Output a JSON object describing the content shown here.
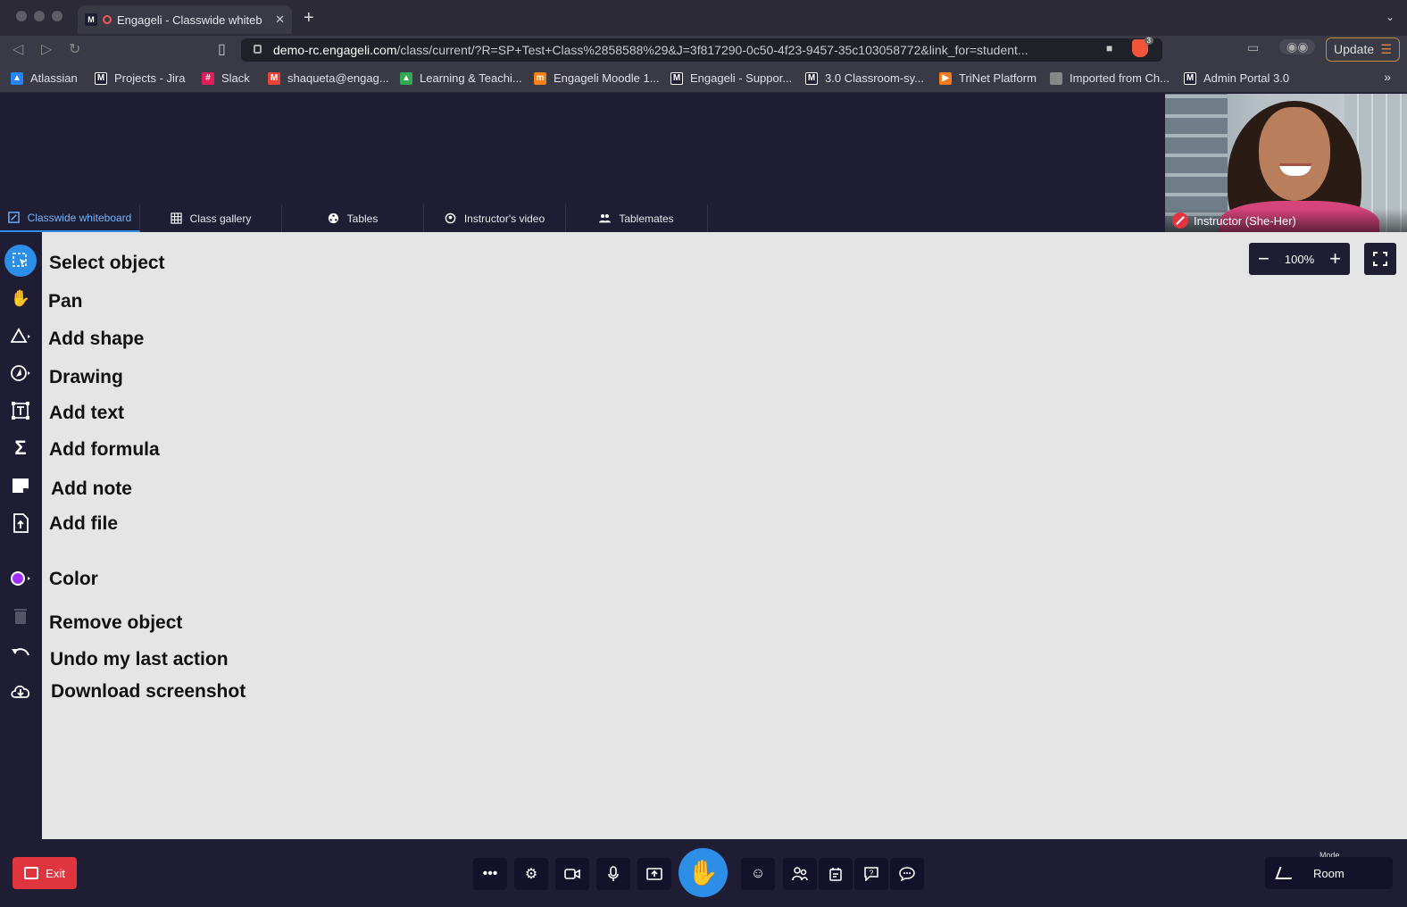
{
  "browser": {
    "tab_title": "Engageli - Classwide whiteb",
    "tab_favicon": "M",
    "url_host": "demo-rc.engageli.com",
    "url_path": "/class/current/?R=SP+Test+Class%2858588%29&J=3f817290-0c50-4f23-9457-35c103058772&link_for=student...",
    "shield_count": "3",
    "update_label": "Update",
    "bookmarks": [
      {
        "label": "Atlassian",
        "color": "#2684ff"
      },
      {
        "label": "Projects - Jira",
        "color": "#1e1d33"
      },
      {
        "label": "Slack",
        "color": "#e01e5a"
      },
      {
        "label": "shaqueta@engag...",
        "color": "#ea4335"
      },
      {
        "label": "Learning & Teachi...",
        "color": "#34a853"
      },
      {
        "label": "Engageli Moodle 1...",
        "color": "#f98012"
      },
      {
        "label": "Engageli - Suppor...",
        "color": "#1e1d33"
      },
      {
        "label": "3.0 Classroom-sy...",
        "color": "#1e1d33"
      },
      {
        "label": "TriNet Platform",
        "color": "#f47b20"
      },
      {
        "label": "Imported from Ch...",
        "color": "#888888"
      },
      {
        "label": "Admin Portal 3.0",
        "color": "#1e1d33"
      }
    ]
  },
  "video": {
    "participant_label": "Instructor (She-Her)"
  },
  "view_tabs": [
    {
      "label": "Classwide whiteboard",
      "icon": "whiteboard-icon"
    },
    {
      "label": "Class gallery",
      "icon": "grid-icon"
    },
    {
      "label": "Tables",
      "icon": "tables-icon"
    },
    {
      "label": "Instructor's video",
      "icon": "instructor-icon"
    },
    {
      "label": "Tablemates",
      "icon": "people-icon"
    }
  ],
  "tools": [
    {
      "label": "Select object",
      "icon": "select-icon"
    },
    {
      "label": "Pan",
      "icon": "hand-icon"
    },
    {
      "label": "Add shape",
      "icon": "shape-icon"
    },
    {
      "label": "Drawing",
      "icon": "drawing-icon"
    },
    {
      "label": "Add text",
      "icon": "text-icon"
    },
    {
      "label": "Add formula",
      "icon": "sigma-icon"
    },
    {
      "label": "Add note",
      "icon": "note-icon"
    },
    {
      "label": "Add file",
      "icon": "file-icon"
    },
    {
      "label": "Color",
      "icon": "color-icon"
    },
    {
      "label": "Remove object",
      "icon": "trash-icon"
    },
    {
      "label": "Undo my last action",
      "icon": "undo-icon"
    },
    {
      "label": "Download screenshot",
      "icon": "download-icon"
    }
  ],
  "zoom": {
    "level": "100%"
  },
  "bottom": {
    "exit_label": "Exit",
    "mode_caption": "Mode",
    "mode_value": "Room"
  },
  "colors": {
    "accent": "#2d8ee8",
    "exit": "#e0343f",
    "color_swatch": "#9b30ff",
    "app_bg": "#1e1d33",
    "canvas_bg": "#e5e5e5"
  }
}
